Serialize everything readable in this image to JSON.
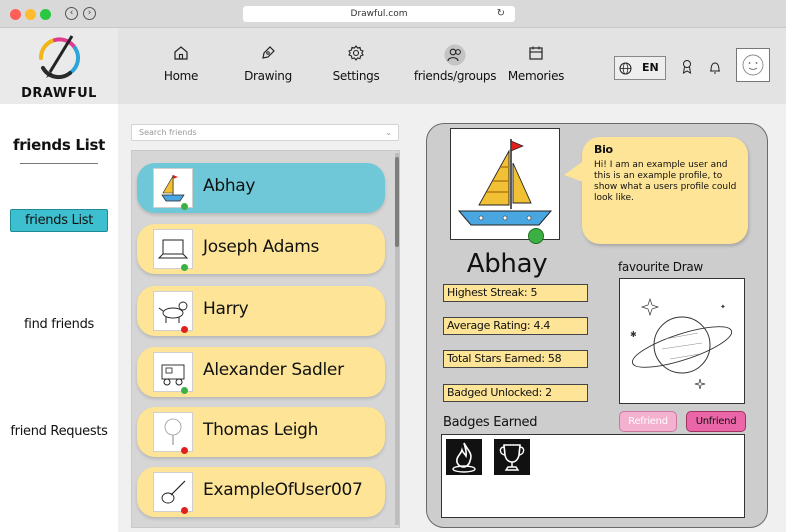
{
  "browser": {
    "url": "Drawful.com",
    "reload_icon": "reload-icon"
  },
  "brand": {
    "name": "DRAWFUL"
  },
  "nav": {
    "items": [
      {
        "label": "Home",
        "icon": "home-icon"
      },
      {
        "label": "Drawing",
        "icon": "pen-icon"
      },
      {
        "label": "Settings",
        "icon": "gear-icon"
      },
      {
        "label": "friends/groups",
        "icon": "people-icon"
      },
      {
        "label": "Memories",
        "icon": "calendar-icon"
      }
    ],
    "language": "EN"
  },
  "sidebar": {
    "title": "friends List",
    "active": "friends List",
    "links": [
      "find friends",
      "friend Requests"
    ]
  },
  "search": {
    "placeholder": "Search friends"
  },
  "friends": [
    {
      "name": "Abhay",
      "status": "online",
      "selected": true
    },
    {
      "name": "Joseph Adams",
      "status": "online"
    },
    {
      "name": "Harry",
      "status": "offline"
    },
    {
      "name": "Alexander Sadler",
      "status": "online"
    },
    {
      "name": "Thomas Leigh",
      "status": "offline"
    },
    {
      "name": "ExampleOfUser007",
      "status": "offline"
    }
  ],
  "profile": {
    "name": "Abhay",
    "bio_title": "Bio",
    "bio_text": "Hi! I am an example user and this is an example profile, to show what a users profile could look like.",
    "stats": [
      "Highest Streak: 5",
      "Average Rating: 4.4",
      "Total Stars Earned: 58",
      "Badged Unlocked: 2"
    ],
    "favourite_label": "favourite Draw",
    "refriend_label": "Refriend",
    "unfriend_label": "Unfriend",
    "badges_label": "Badges Earned",
    "badges": [
      "flame-badge-icon",
      "trophy-badge-icon"
    ]
  },
  "colors": {
    "online": "#3cb043",
    "offline": "#e0201c",
    "card": "#fde497",
    "selected_card": "#6ec8d8",
    "unfriend": "#ea66a8"
  }
}
